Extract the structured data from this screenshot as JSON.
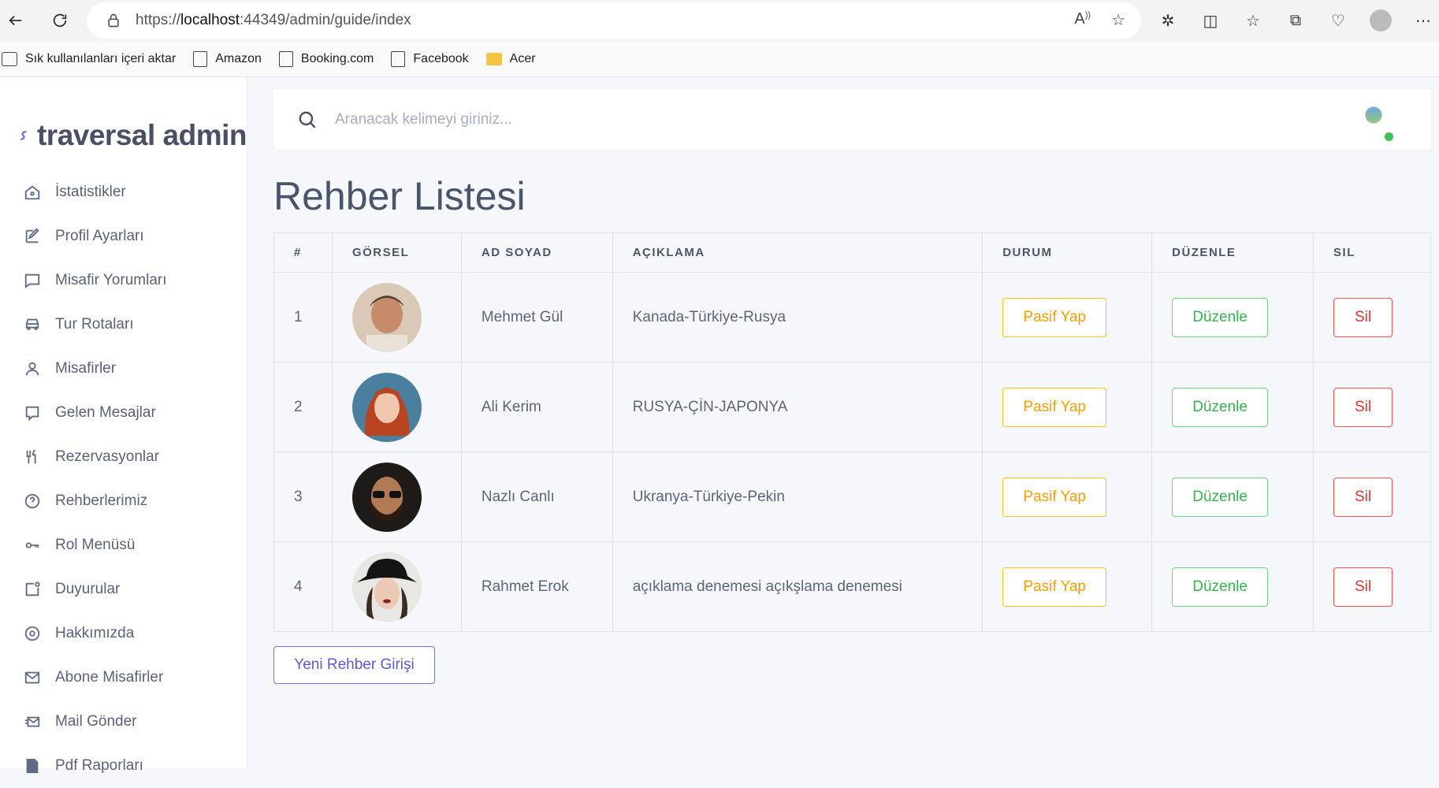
{
  "browser": {
    "url_prefix": "https://",
    "url_host": "localhost",
    "url_rest": ":44349/admin/guide/index",
    "bookmarks": [
      {
        "label": "Sık kullanılanları içeri aktar",
        "icon": "import-icon"
      },
      {
        "label": "Amazon",
        "icon": "page-icon"
      },
      {
        "label": "Booking.com",
        "icon": "page-icon"
      },
      {
        "label": "Facebook",
        "icon": "page-icon"
      },
      {
        "label": "Acer",
        "icon": "folder-icon"
      }
    ]
  },
  "sidebar": {
    "brand": "traversal admin",
    "items": [
      {
        "label": "İstatistikler",
        "icon": "home-icon"
      },
      {
        "label": "Profil Ayarları",
        "icon": "edit-icon"
      },
      {
        "label": "Misafir Yorumları",
        "icon": "comment-icon"
      },
      {
        "label": "Tur Rotaları",
        "icon": "car-icon"
      },
      {
        "label": "Misafirler",
        "icon": "user-icon"
      },
      {
        "label": "Gelen Mesajlar",
        "icon": "message-icon"
      },
      {
        "label": "Rezervasyonlar",
        "icon": "utensils-icon"
      },
      {
        "label": "Rehberlerimiz",
        "icon": "help-icon"
      },
      {
        "label": "Rol Menüsü",
        "icon": "key-icon"
      },
      {
        "label": "Duyurular",
        "icon": "announcement-icon"
      },
      {
        "label": "Hakkımızda",
        "icon": "info-circle-icon"
      },
      {
        "label": "Abone Misafirler",
        "icon": "mail-icon"
      },
      {
        "label": "Mail Gönder",
        "icon": "send-mail-icon"
      },
      {
        "label": "Pdf Raporları",
        "icon": "pdf-icon"
      }
    ]
  },
  "search": {
    "placeholder": "Aranacak kelimeyi giriniz..."
  },
  "page": {
    "title": "Rehber Listesi",
    "new_button": "Yeni Rehber Girişi"
  },
  "table": {
    "headers": [
      "#",
      "GÖRSEL",
      "AD SOYAD",
      "AÇIKLAMA",
      "DURUM",
      "DÜZENLE",
      "SIL"
    ],
    "rows": [
      {
        "id": "1",
        "name": "Mehmet Gül",
        "desc": "Kanada-Türkiye-Rusya",
        "status_btn": "Pasif Yap",
        "edit_btn": "Düzenle",
        "delete_btn": "Sil"
      },
      {
        "id": "2",
        "name": "Ali Kerim",
        "desc": "RUSYA-ÇİN-JAPONYA",
        "status_btn": "Pasif Yap",
        "edit_btn": "Düzenle",
        "delete_btn": "Sil"
      },
      {
        "id": "3",
        "name": "Nazlı Canlı",
        "desc": "Ukranya-Türkiye-Pekin",
        "status_btn": "Pasif Yap",
        "edit_btn": "Düzenle",
        "delete_btn": "Sil"
      },
      {
        "id": "4",
        "name": "Rahmet Erok",
        "desc": "açıklama denemesi açıkşlama denemesi",
        "status_btn": "Pasif Yap",
        "edit_btn": "Düzenle",
        "delete_btn": "Sil"
      }
    ]
  },
  "colors": {
    "warning": "#f59f00",
    "success": "#37b24d",
    "danger": "#e03131",
    "primary": "#5b5bd6",
    "online": "#40c057"
  }
}
